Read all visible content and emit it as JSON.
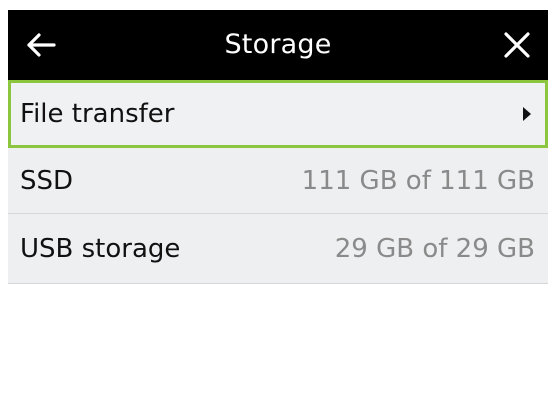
{
  "header": {
    "title": "Storage",
    "back_icon": "back-arrow-icon",
    "close_icon": "close-icon"
  },
  "items": [
    {
      "label": "File transfer",
      "value": "",
      "icon": "chevron-right-icon",
      "selected": true
    },
    {
      "label": "SSD",
      "value": "111 GB of 111 GB"
    },
    {
      "label": "USB storage",
      "value": "29 GB of 29 GB"
    }
  ],
  "colors": {
    "header_bg": "#000000",
    "row_bg": "#eeeff0",
    "selection_border": "#8cc63f",
    "value_text": "#8a8a8a"
  }
}
